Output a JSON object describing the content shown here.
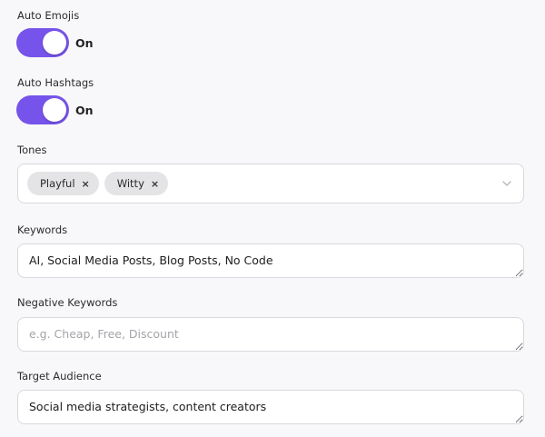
{
  "auto_emojis": {
    "label": "Auto Emojis",
    "state": "On",
    "enabled": true
  },
  "auto_hashtags": {
    "label": "Auto Hashtags",
    "state": "On",
    "enabled": true
  },
  "tones": {
    "label": "Tones",
    "chips": [
      {
        "label": "Playful",
        "remove": "×"
      },
      {
        "label": "Witty",
        "remove": "×"
      }
    ]
  },
  "keywords": {
    "label": "Keywords",
    "value": "AI, Social Media Posts, Blog Posts, No Code"
  },
  "negative_keywords": {
    "label": "Negative Keywords",
    "value": "",
    "placeholder": "e.g. Cheap, Free, Discount"
  },
  "target_audience": {
    "label": "Target Audience",
    "value": "Social media strategists, content creators"
  },
  "colors": {
    "accent": "#7653EA",
    "chip_bg": "#E4E4E6",
    "page_bg": "#F8F8FA"
  },
  "icons": {
    "chip_remove": "close-icon",
    "select_toggle": "chevron-down-icon"
  }
}
